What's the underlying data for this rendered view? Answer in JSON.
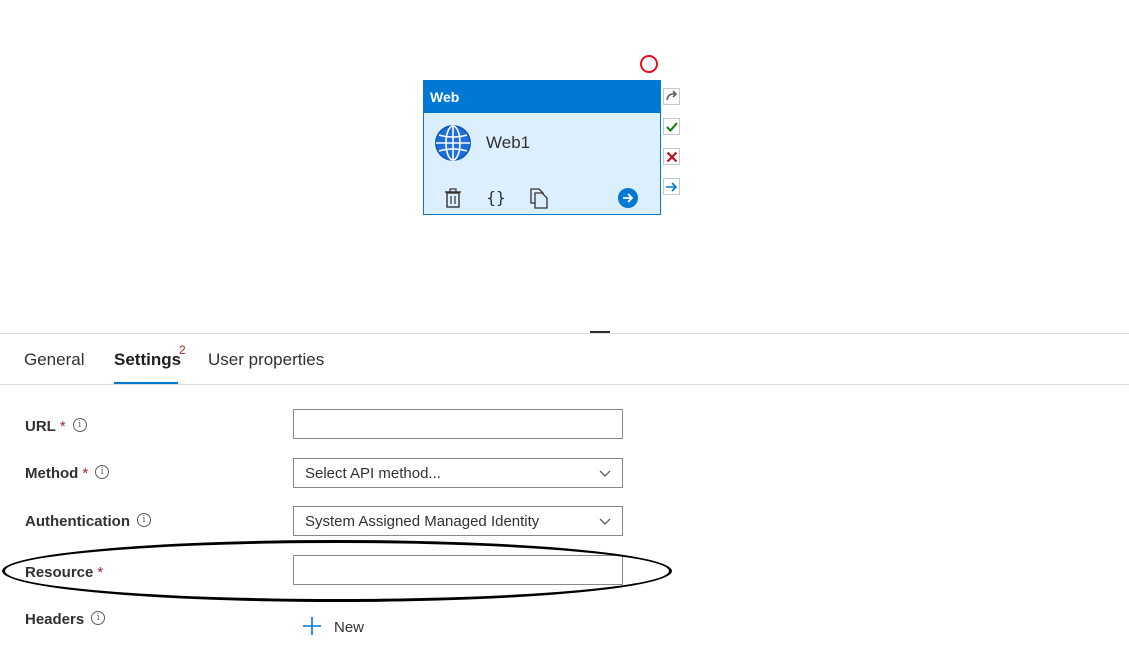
{
  "activity": {
    "type_label": "Web",
    "name": "Web1"
  },
  "tabs": [
    {
      "label": "General"
    },
    {
      "label": "Settings",
      "badge": "2"
    },
    {
      "label": "User properties"
    }
  ],
  "form": {
    "url": {
      "label": "URL",
      "value": ""
    },
    "method": {
      "label": "Method",
      "value": "Select API method..."
    },
    "authentication": {
      "label": "Authentication",
      "value": "System Assigned Managed Identity"
    },
    "resource": {
      "label": "Resource",
      "value": ""
    },
    "headers": {
      "label": "Headers",
      "new_label": "New"
    }
  },
  "required_mark": "*",
  "info_glyph": "i",
  "colors": {
    "accent": "#0078d4",
    "required": "#a4262c",
    "error": "#e81123",
    "success": "#107c10"
  }
}
